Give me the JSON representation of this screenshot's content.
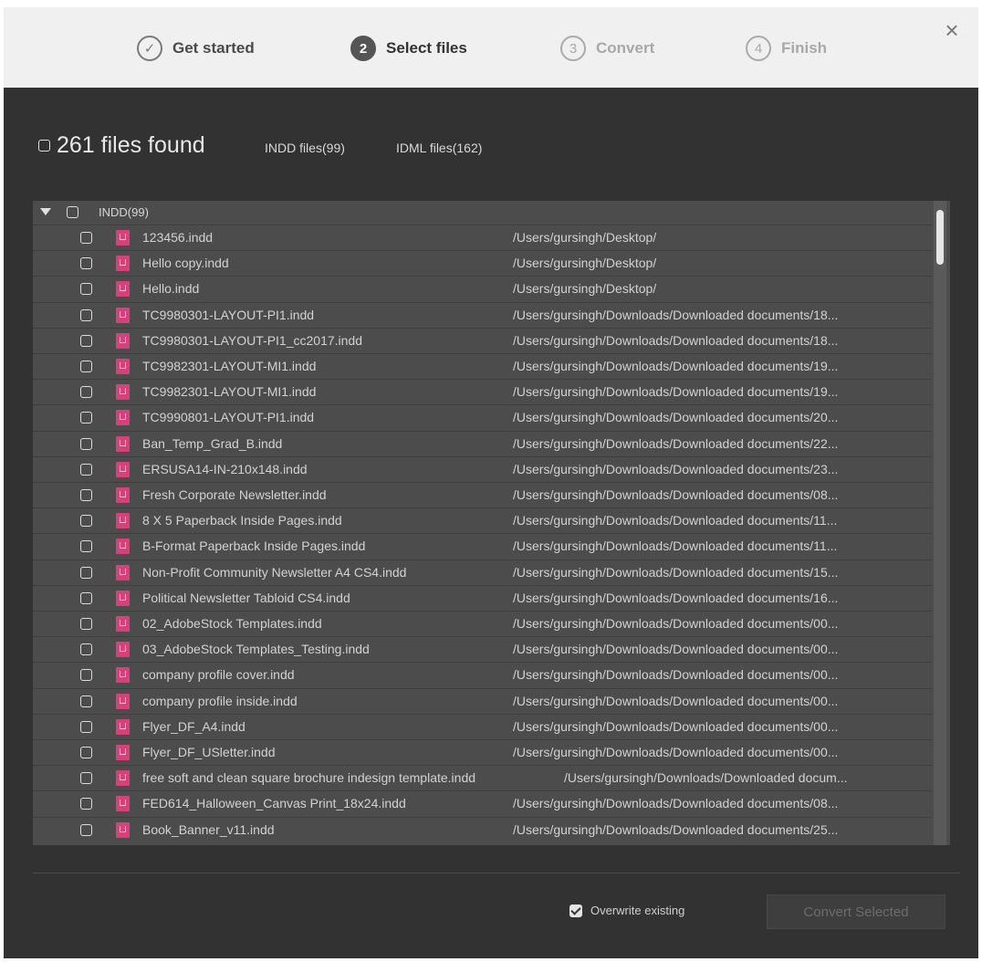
{
  "stepper": {
    "steps": [
      {
        "number": "✓",
        "label": "Get started"
      },
      {
        "number": "2",
        "label": "Select files"
      },
      {
        "number": "3",
        "label": "Convert"
      },
      {
        "number": "4",
        "label": "Finish"
      }
    ],
    "close_label": "×"
  },
  "summary": {
    "found_text": "261 files found",
    "filters": [
      "INDD files(99)",
      "IDML files(162)"
    ]
  },
  "list": {
    "group_label": "INDD(99)",
    "rows": [
      {
        "name": "123456.indd",
        "path": "/Users/gursingh/Desktop/"
      },
      {
        "name": "Hello copy.indd",
        "path": "/Users/gursingh/Desktop/"
      },
      {
        "name": "Hello.indd",
        "path": "/Users/gursingh/Desktop/"
      },
      {
        "name": "TC9980301-LAYOUT-PI1.indd",
        "path": "/Users/gursingh/Downloads/Downloaded documents/18..."
      },
      {
        "name": "TC9980301-LAYOUT-PI1_cc2017.indd",
        "path": "/Users/gursingh/Downloads/Downloaded documents/18..."
      },
      {
        "name": "TC9982301-LAYOUT-MI1.indd",
        "path": "/Users/gursingh/Downloads/Downloaded documents/19..."
      },
      {
        "name": "TC9982301-LAYOUT-MI1.indd",
        "path": "/Users/gursingh/Downloads/Downloaded documents/19..."
      },
      {
        "name": "TC9990801-LAYOUT-PI1.indd",
        "path": "/Users/gursingh/Downloads/Downloaded documents/20..."
      },
      {
        "name": "Ban_Temp_Grad_B.indd",
        "path": "/Users/gursingh/Downloads/Downloaded documents/22..."
      },
      {
        "name": "ERSUSA14-IN-210x148.indd",
        "path": "/Users/gursingh/Downloads/Downloaded documents/23..."
      },
      {
        "name": "Fresh Corporate Newsletter.indd",
        "path": "/Users/gursingh/Downloads/Downloaded documents/08..."
      },
      {
        "name": "8 X 5 Paperback Inside Pages.indd",
        "path": "/Users/gursingh/Downloads/Downloaded documents/11..."
      },
      {
        "name": "B-Format Paperback Inside Pages.indd",
        "path": "/Users/gursingh/Downloads/Downloaded documents/11..."
      },
      {
        "name": "Non-Profit Community Newsletter A4 CS4.indd",
        "path": "/Users/gursingh/Downloads/Downloaded documents/15..."
      },
      {
        "name": "Political Newsletter Tabloid CS4.indd",
        "path": "/Users/gursingh/Downloads/Downloaded documents/16..."
      },
      {
        "name": "02_AdobeStock Templates.indd",
        "path": "/Users/gursingh/Downloads/Downloaded documents/00..."
      },
      {
        "name": "03_AdobeStock Templates_Testing.indd",
        "path": "/Users/gursingh/Downloads/Downloaded documents/00..."
      },
      {
        "name": "company profile cover.indd",
        "path": "/Users/gursingh/Downloads/Downloaded documents/00..."
      },
      {
        "name": "company profile inside.indd",
        "path": "/Users/gursingh/Downloads/Downloaded documents/00..."
      },
      {
        "name": "Flyer_DF_A4.indd",
        "path": "/Users/gursingh/Downloads/Downloaded documents/00..."
      },
      {
        "name": "Flyer_DF_USletter.indd",
        "path": "/Users/gursingh/Downloads/Downloaded documents/00..."
      },
      {
        "name": "free soft and clean square brochure indesign template.indd",
        "path": "/Users/gursingh/Downloads/Downloaded docum..."
      },
      {
        "name": "FED614_Halloween_Canvas Print_18x24.indd",
        "path": "/Users/gursingh/Downloads/Downloaded documents/08..."
      },
      {
        "name": "Book_Banner_v11.indd",
        "path": "/Users/gursingh/Downloads/Downloaded documents/25..."
      }
    ]
  },
  "footer": {
    "overwrite_label": "Overwrite existing",
    "convert_label": "Convert Selected"
  },
  "colors": {
    "dialog_bg": "#323232",
    "header_bg": "#f0f0f0",
    "list_bg": "#4c4c4c",
    "indd_icon": "#d9407a"
  }
}
